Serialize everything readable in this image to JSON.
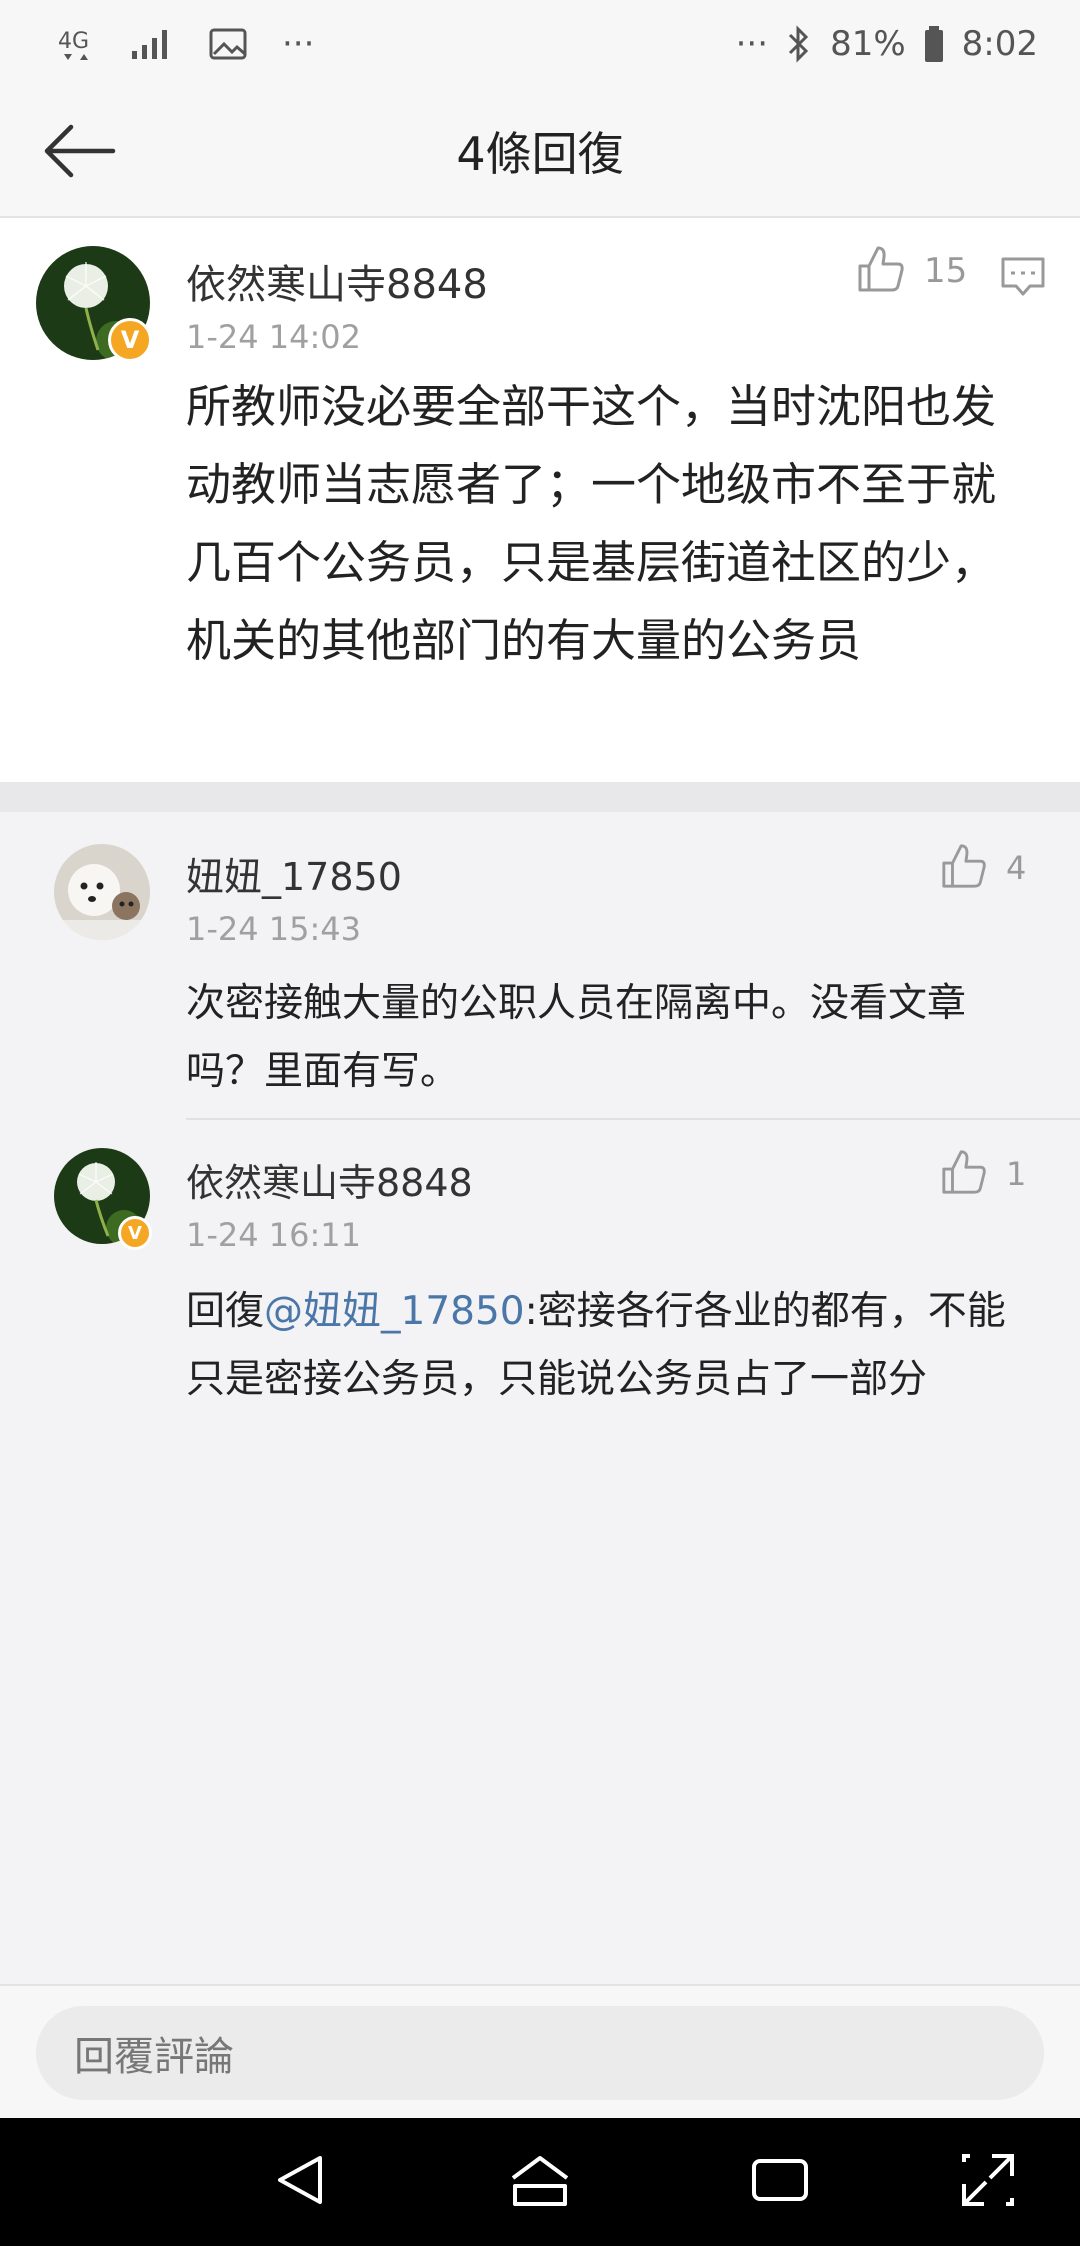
{
  "status_bar": {
    "network": "4G",
    "ellipsis_left": "···",
    "ellipsis_right": "···",
    "battery": "81%",
    "time": "8:02"
  },
  "header": {
    "title": "4條回復"
  },
  "main_comment": {
    "username": "依然寒山寺8848",
    "time": "1-24 14:02",
    "likes": "15",
    "text": "所教师没必要全部干这个，当时沈阳也发动教师当志愿者了；一个地级市不至于就几百个公务员，只是基层街道社区的少，机关的其他部门的有大量的公务员"
  },
  "replies": [
    {
      "username": "妞妞_17850",
      "time": "1-24 15:43",
      "likes": "4",
      "text": "次密接触大量的公职人员在隔离中。没看文章吗？里面有写。"
    },
    {
      "username": "依然寒山寺8848",
      "time": "1-24 16:11",
      "likes": "1",
      "prefix": "回復",
      "mention": "@妞妞_17850",
      "text": ":密接各行各业的都有，不能只是密接公务员，只能说公务员占了一部分"
    }
  ],
  "input": {
    "placeholder": "回覆評論"
  },
  "icons": {
    "back": "back-arrow-icon",
    "like": "thumbs-up-icon",
    "comment": "comment-bubble-icon",
    "verified": "verified-badge-icon"
  },
  "colors": {
    "mention": "#4a76a8",
    "badge": "#f5a623"
  }
}
